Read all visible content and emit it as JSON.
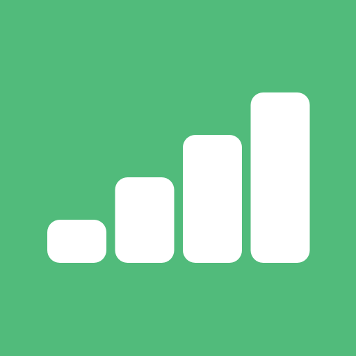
{
  "icon": {
    "name": "signal-bars-icon",
    "background_color": "#51bb7b",
    "bar_color": "#ffffff",
    "levels": [
      1,
      2,
      3,
      4
    ]
  }
}
